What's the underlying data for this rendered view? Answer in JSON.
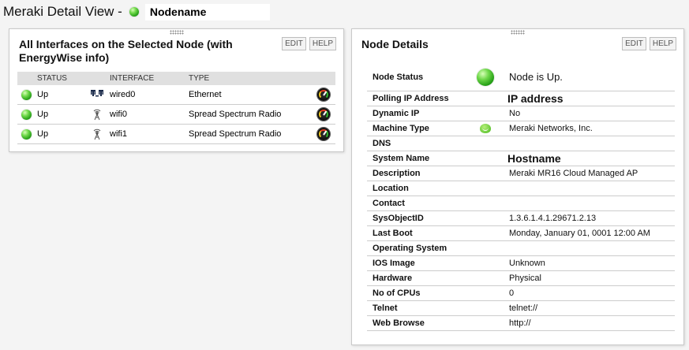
{
  "header": {
    "title": "Meraki Detail View -",
    "node_name": "Nodename"
  },
  "interfaces_panel": {
    "title": "All Interfaces on the Selected Node (with EnergyWise info)",
    "edit_label": "EDIT",
    "help_label": "HELP",
    "columns": {
      "status": "STATUS",
      "interface": "INTERFACE",
      "type": "TYPE"
    },
    "rows": [
      {
        "status": "Up",
        "icon": "ethernet-port-icon",
        "interface": "wired0",
        "type": "Ethernet"
      },
      {
        "status": "Up",
        "icon": "wireless-antenna-icon",
        "interface": "wifi0",
        "type": "Spread Spectrum Radio"
      },
      {
        "status": "Up",
        "icon": "wireless-antenna-icon",
        "interface": "wifi1",
        "type": "Spread Spectrum Radio"
      }
    ]
  },
  "details_panel": {
    "title": "Node Details",
    "edit_label": "EDIT",
    "help_label": "HELP",
    "node_status": {
      "label": "Node Status",
      "value": "Node is Up."
    },
    "rows": [
      {
        "label": "Polling IP Address",
        "value": "IP address"
      },
      {
        "label": "Dynamic IP",
        "value": "No"
      },
      {
        "label": "Machine Type",
        "value": "Meraki Networks, Inc."
      },
      {
        "label": "DNS",
        "value": ""
      },
      {
        "label": "System Name",
        "value": "Hostname"
      },
      {
        "label": "Description",
        "value": "Meraki MR16 Cloud Managed AP"
      },
      {
        "label": "Location",
        "value": ""
      },
      {
        "label": "Contact",
        "value": ""
      },
      {
        "label": "SysObjectID",
        "value": "1.3.6.1.4.1.29671.2.13"
      },
      {
        "label": "Last Boot",
        "value": "Monday, January 01, 0001 12:00 AM"
      },
      {
        "label": "Operating System",
        "value": ""
      },
      {
        "label": "IOS Image",
        "value": "Unknown"
      },
      {
        "label": "Hardware",
        "value": "Physical"
      },
      {
        "label": "No of CPUs",
        "value": "0"
      },
      {
        "label": "Telnet",
        "value": "telnet://"
      },
      {
        "label": "Web Browse",
        "value": "http://"
      }
    ]
  },
  "colors": {
    "status_up": "#2fa51c",
    "panel_border": "#c9c9c9",
    "table_header": "#e0e0e0"
  }
}
